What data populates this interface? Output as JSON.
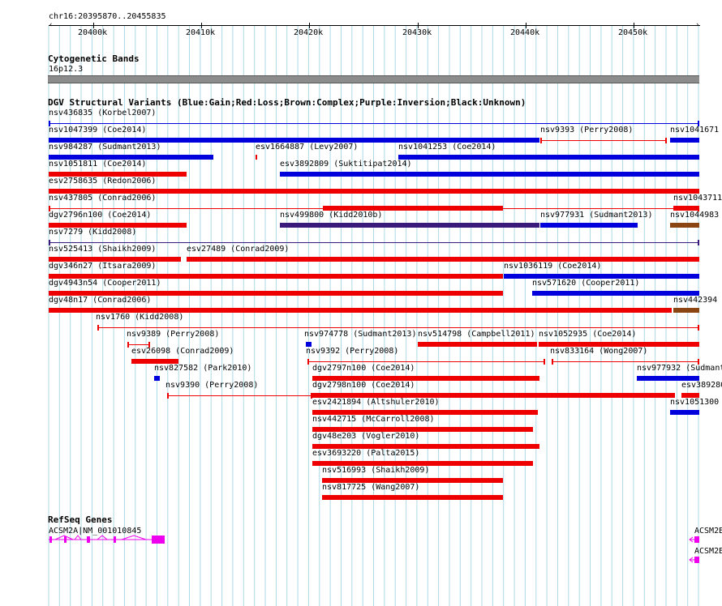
{
  "ruler": {
    "coord": "chr16:20395870..20455835",
    "ticks": [
      "20400k",
      "20410k",
      "20420k",
      "20430k",
      "20440k",
      "20450k"
    ]
  },
  "cytoband": {
    "title": "Cytogenetic Bands",
    "band": "16p12.3"
  },
  "dgv": {
    "title": "DGV Structural Variants (Blue:Gain;Red:Loss;Brown:Complex;Purple:Inversion;Black:Unknown)",
    "features": [
      {
        "label": "nsv436835 (Korbel2007)",
        "color": "blue",
        "style": "line"
      },
      {
        "label": "nsv1047399 (Coe2014)",
        "color": "blue",
        "style": "bar"
      },
      {
        "label": "nsv9393 (Perry2008)",
        "color": "red",
        "style": "line"
      },
      {
        "label": "nsv1041671",
        "color": "blue",
        "style": "bar"
      },
      {
        "label": "nsv984287 (Sudmant2013)",
        "color": "blue",
        "style": "bar"
      },
      {
        "label": "esv1664887 (Levy2007)",
        "color": "red",
        "style": "bar"
      },
      {
        "label": "nsv1041253 (Coe2014)",
        "color": "blue",
        "style": "bar"
      },
      {
        "label": "nsv1051811 (Coe2014)",
        "color": "red",
        "style": "bar"
      },
      {
        "label": "esv3892809 (Suktitipat2014)",
        "color": "blue",
        "style": "bar"
      },
      {
        "label": "esv2758635 (Redon2006)",
        "color": "red",
        "style": "bar"
      },
      {
        "label": "nsv437805 (Conrad2006)",
        "color": "red",
        "style": "line"
      },
      {
        "label": "nsv1043711",
        "color": "red",
        "style": "bar"
      },
      {
        "label": "dgv2796n100 (Coe2014)",
        "color": "red",
        "style": "bar"
      },
      {
        "label": "nsv499800 (Kidd2010b)",
        "color": "purple",
        "style": "bar"
      },
      {
        "label": "nsv977931 (Sudmant2013)",
        "color": "blue",
        "style": "bar"
      },
      {
        "label": "nsv1044983",
        "color": "brown",
        "style": "bar"
      },
      {
        "label": "nsv7279 (Kidd2008)",
        "color": "purple",
        "style": "line"
      },
      {
        "label": "nsv525413 (Shaikh2009)",
        "color": "red",
        "style": "bar"
      },
      {
        "label": "esv27489 (Conrad2009)",
        "color": "red",
        "style": "bar"
      },
      {
        "label": "dgv346n27 (Itsara2009)",
        "color": "red",
        "style": "bar"
      },
      {
        "label": "nsv1036119 (Coe2014)",
        "color": "blue",
        "style": "bar"
      },
      {
        "label": "dgv4943n54 (Cooper2011)",
        "color": "red",
        "style": "bar"
      },
      {
        "label": "nsv571620 (Cooper2011)",
        "color": "blue",
        "style": "bar"
      },
      {
        "label": "dgv48n17 (Conrad2006)",
        "color": "red",
        "style": "bar"
      },
      {
        "label": "nsv442394",
        "color": "brown",
        "style": "bar"
      },
      {
        "label": "nsv1760 (Kidd2008)",
        "color": "red",
        "style": "line"
      },
      {
        "label": "nsv9389 (Perry2008)",
        "color": "red",
        "style": "line"
      },
      {
        "label": "nsv974778 (Sudmant2013)",
        "color": "blue",
        "style": "bar"
      },
      {
        "label": "nsv514798 (Campbell2011)",
        "color": "red",
        "style": "bar"
      },
      {
        "label": "nsv1052935 (Coe2014)",
        "color": "red",
        "style": "bar"
      },
      {
        "label": "esv26098 (Conrad2009)",
        "color": "red",
        "style": "bar"
      },
      {
        "label": "nsv9392 (Perry2008)",
        "color": "red",
        "style": "line"
      },
      {
        "label": "nsv833164 (Wong2007)",
        "color": "red",
        "style": "line"
      },
      {
        "label": "nsv827582 (Park2010)",
        "color": "blue",
        "style": "bar"
      },
      {
        "label": "dgv2797n100 (Coe2014)",
        "color": "red",
        "style": "bar"
      },
      {
        "label": "nsv977932 (Sudmant",
        "color": "blue",
        "style": "bar"
      },
      {
        "label": "nsv9390 (Perry2008)",
        "color": "red",
        "style": "line"
      },
      {
        "label": "dgv2798n100 (Coe2014)",
        "color": "red",
        "style": "bar"
      },
      {
        "label": "esv389280",
        "color": "red",
        "style": "bar"
      },
      {
        "label": "esv2421894 (Altshuler2010)",
        "color": "red",
        "style": "bar"
      },
      {
        "label": "nsv1051300",
        "color": "blue",
        "style": "bar"
      },
      {
        "label": "nsv442715 (McCarroll2008)",
        "color": "red",
        "style": "bar"
      },
      {
        "label": "dgv48e203 (Vogler2010)",
        "color": "red",
        "style": "bar"
      },
      {
        "label": "esv3693220 (Palta2015)",
        "color": "red",
        "style": "bar"
      },
      {
        "label": "nsv516993 (Shaikh2009)",
        "color": "red",
        "style": "bar"
      },
      {
        "label": "nsv817725 (Wang2007)",
        "color": "red",
        "style": "bar"
      }
    ]
  },
  "refseq": {
    "title": "RefSeq Genes",
    "genes": [
      {
        "label": "ACSM2A|NM_001010845"
      },
      {
        "label": "ACSM2B"
      },
      {
        "label": "ACSM2B"
      }
    ]
  },
  "colors": {
    "blue": "#0000dd",
    "red": "#ee0000",
    "purple": "#3a1a7a",
    "brown": "#8b4513",
    "gene": "#ee00ee",
    "grid": "#add8e6"
  }
}
